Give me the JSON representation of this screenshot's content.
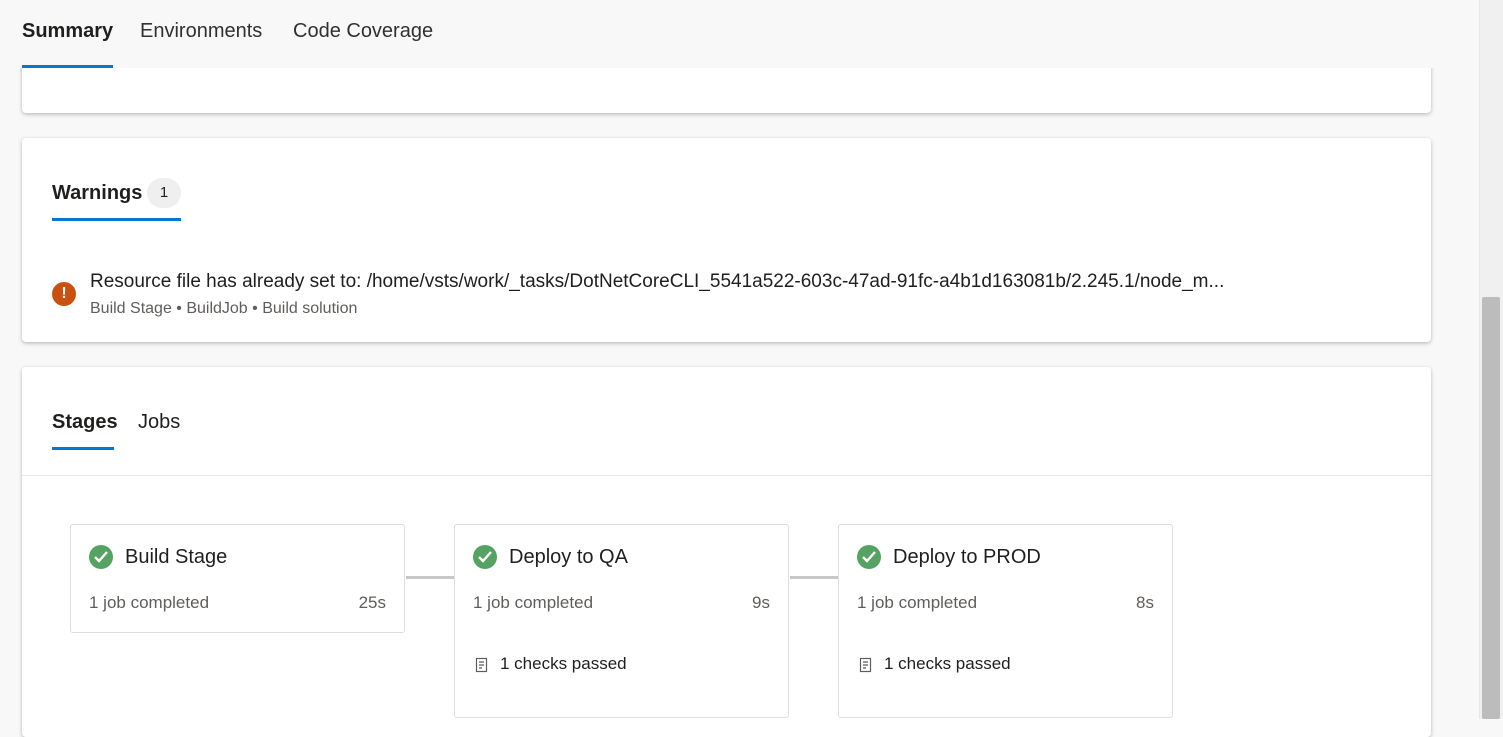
{
  "top_tabs": [
    {
      "label": "Summary"
    },
    {
      "label": "Environments"
    },
    {
      "label": "Code Coverage"
    }
  ],
  "warnings": {
    "title": "Warnings",
    "count": "1",
    "items": [
      {
        "message": "Resource file has already set to: /home/vsts/work/_tasks/DotNetCoreCLI_5541a522-603c-47ad-91fc-a4b1d163081b/2.245.1/node_m...",
        "path": "Build Stage • BuildJob • Build solution",
        "icon": "!",
        "color": "#ca5010"
      }
    ]
  },
  "stages_section": {
    "tabs": [
      {
        "label": "Stages"
      },
      {
        "label": "Jobs"
      }
    ],
    "stages": [
      {
        "name": "Build Stage",
        "status": "1 job completed",
        "duration": "25s",
        "checks": ""
      },
      {
        "name": "Deploy to QA",
        "status": "1 job completed",
        "duration": "9s",
        "checks": "1 checks passed"
      },
      {
        "name": "Deploy to PROD",
        "status": "1 job completed",
        "duration": "8s",
        "checks": "1 checks passed"
      }
    ]
  },
  "colors": {
    "accent": "#0078d4",
    "success": "#55a362",
    "warning": "#ca5010"
  }
}
